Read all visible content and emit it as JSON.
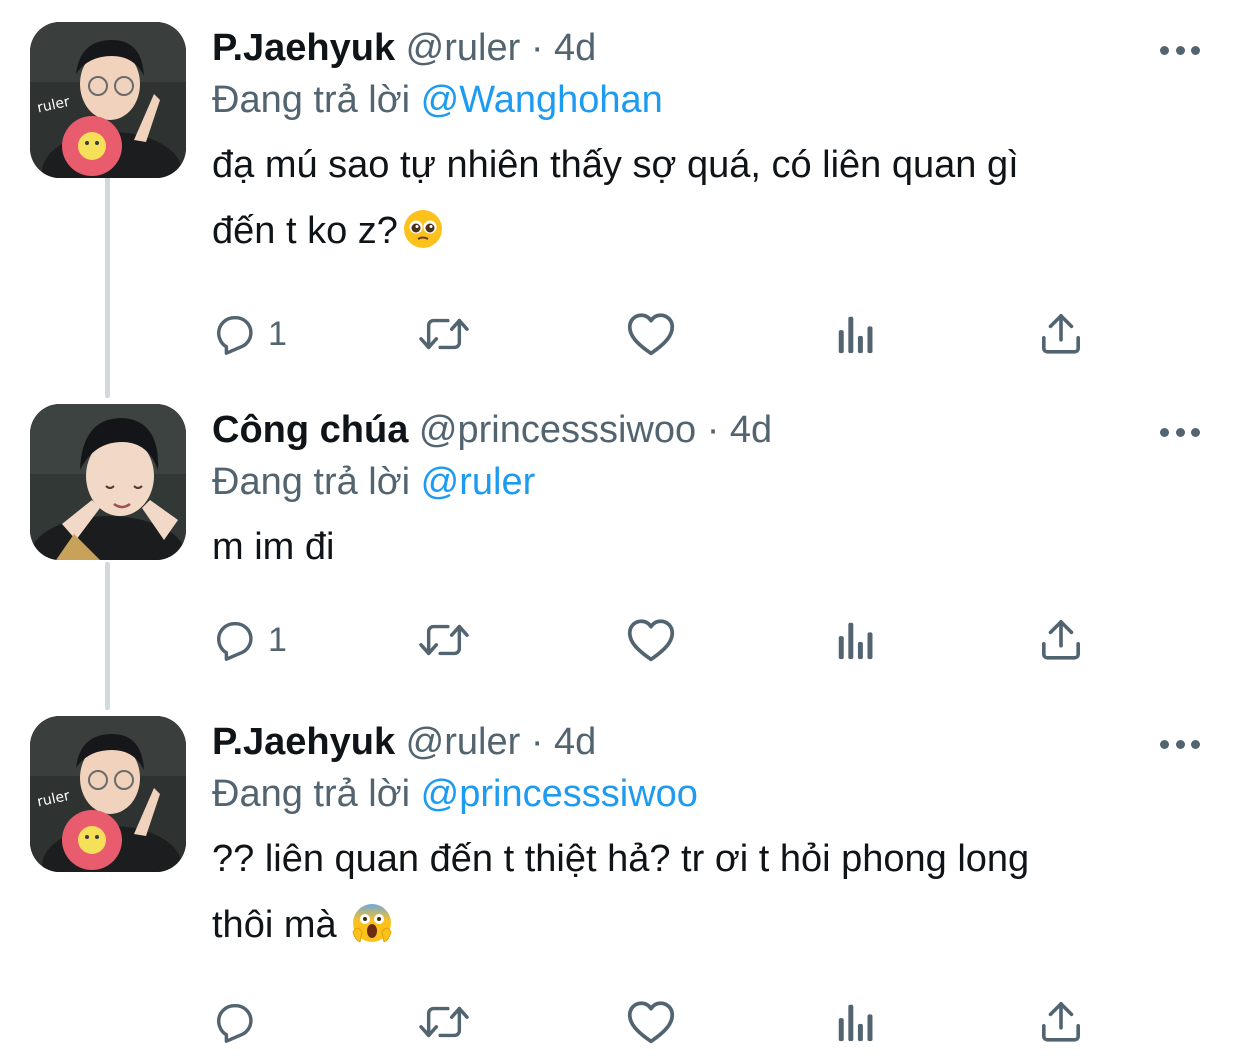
{
  "icons": {
    "reply": "reply-icon",
    "retweet": "retweet-icon",
    "like": "heart-icon",
    "views": "analytics-icon",
    "share": "share-icon",
    "more": "more-icon"
  },
  "colors": {
    "link": "#1d9bf0",
    "secondary": "#536471",
    "text": "#0f1419",
    "thread_line": "#cfd9de"
  },
  "tweets": [
    {
      "display_name": "P.Jaehyuk",
      "handle": "@ruler",
      "separator": "·",
      "time": "4d",
      "replying_prefix": "Đang trả lời",
      "replying_to": "@Wanghohan",
      "text_line1": "đạ mú sao tự nhiên thấy sợ quá, có liên quan gì",
      "text_line2": "đến t ko z?",
      "emoji": "pleading-face-emoji",
      "reply_count": "1"
    },
    {
      "display_name": "Công chúa",
      "handle": "@princesssiwoo",
      "separator": "·",
      "time": "4d",
      "replying_prefix": "Đang trả lời",
      "replying_to": "@ruler",
      "text_line1": "m im đi",
      "reply_count": "1"
    },
    {
      "display_name": "P.Jaehyuk",
      "handle": "@ruler",
      "separator": "·",
      "time": "4d",
      "replying_prefix": "Đang trả lời",
      "replying_to": "@princesssiwoo",
      "text_line1": "?? liên quan đến t thiệt hả? tr ơi t hỏi phong long",
      "text_line2": "thôi mà",
      "emoji": "screaming-face-emoji",
      "reply_count": ""
    }
  ]
}
